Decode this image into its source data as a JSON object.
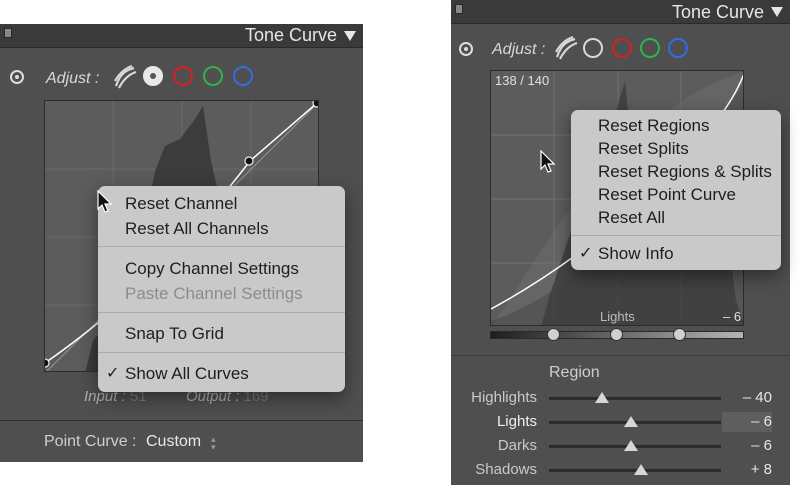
{
  "left_panel": {
    "header": {
      "title": "Tone Curve"
    },
    "adjust_label": "Adjust :",
    "context_menu": {
      "items": [
        {
          "label": "Reset Channel",
          "enabled": true
        },
        {
          "label": "Reset All Channels",
          "enabled": true
        },
        {
          "label": "Copy Channel Settings",
          "enabled": true
        },
        {
          "label": "Paste Channel Settings",
          "enabled": false
        },
        {
          "label": "Snap To Grid",
          "enabled": true
        },
        {
          "label": "Show All Curves",
          "enabled": true,
          "checked": true
        }
      ],
      "check_mark": "✓"
    },
    "input_label": "Input :",
    "input_value": "51",
    "output_label": "Output :",
    "output_value": "169",
    "point_curve_label": "Point Curve :",
    "point_curve_value": "Custom"
  },
  "right_panel": {
    "header": {
      "title": "Tone Curve"
    },
    "adjust_label": "Adjust :",
    "graph_readout": "138 / 140",
    "graph_region_label": "Lights",
    "graph_region_value": "– 6",
    "context_menu": {
      "items": [
        {
          "label": "Reset Regions",
          "enabled": true
        },
        {
          "label": "Reset Splits",
          "enabled": true
        },
        {
          "label": "Reset Regions & Splits",
          "enabled": true
        },
        {
          "label": "Reset Point Curve",
          "enabled": true
        },
        {
          "label": "Reset All",
          "enabled": true
        },
        {
          "label": "Show Info",
          "enabled": true,
          "checked": true
        }
      ],
      "check_mark": "✓"
    },
    "region_title": "Region",
    "sliders": [
      {
        "label": "Highlights",
        "value": "– 40",
        "level": -40
      },
      {
        "label": "Lights",
        "value": "– 6",
        "level": -6,
        "active": true
      },
      {
        "label": "Darks",
        "value": "– 6",
        "level": -6
      },
      {
        "label": "Shadows",
        "value": "+ 8",
        "level": 8
      }
    ]
  },
  "colors": {
    "panel_bg": "#4f4f4f",
    "header_bg": "#3a3a3a",
    "menu_bg": "#c9c9c9",
    "red_channel": "#d81f26",
    "green_channel": "#2fb34a",
    "blue_channel": "#2f6fe0"
  },
  "icons": [
    "target-adjust-icon",
    "rgb-channels-icon",
    "collapse-icon",
    "triangle-down-icon",
    "arrow-cursor-icon",
    "checkmark-icon"
  ]
}
